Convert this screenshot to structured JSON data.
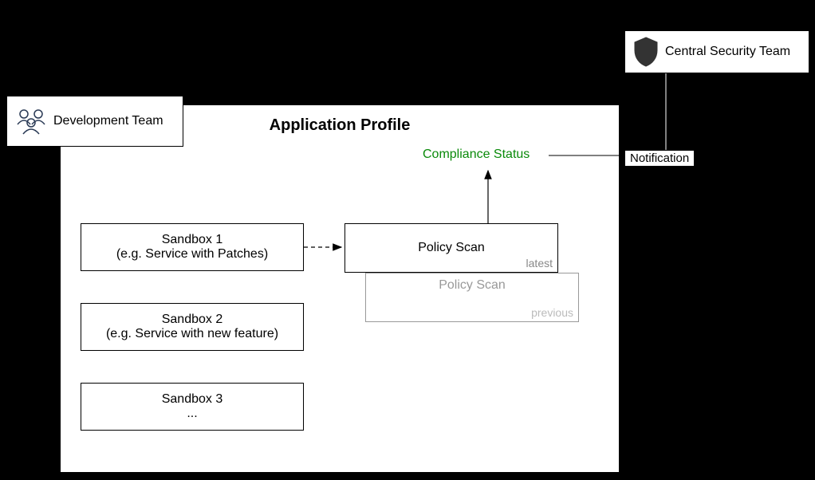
{
  "teams": {
    "development": "Development Team",
    "security": "Central Security Team"
  },
  "profile": {
    "title": "Application Profile",
    "compliance_status": "Compliance Status",
    "sandboxes": [
      {
        "title": "Sandbox 1",
        "subtitle": "(e.g. Service with Patches)"
      },
      {
        "title": "Sandbox 2",
        "subtitle": "(e.g. Service with new feature)"
      },
      {
        "title": "Sandbox 3",
        "subtitle": "..."
      }
    ],
    "policy_scan": {
      "label": "Policy Scan",
      "latest_tag": "latest",
      "previous_tag": "previous"
    }
  },
  "notification": "Notification"
}
